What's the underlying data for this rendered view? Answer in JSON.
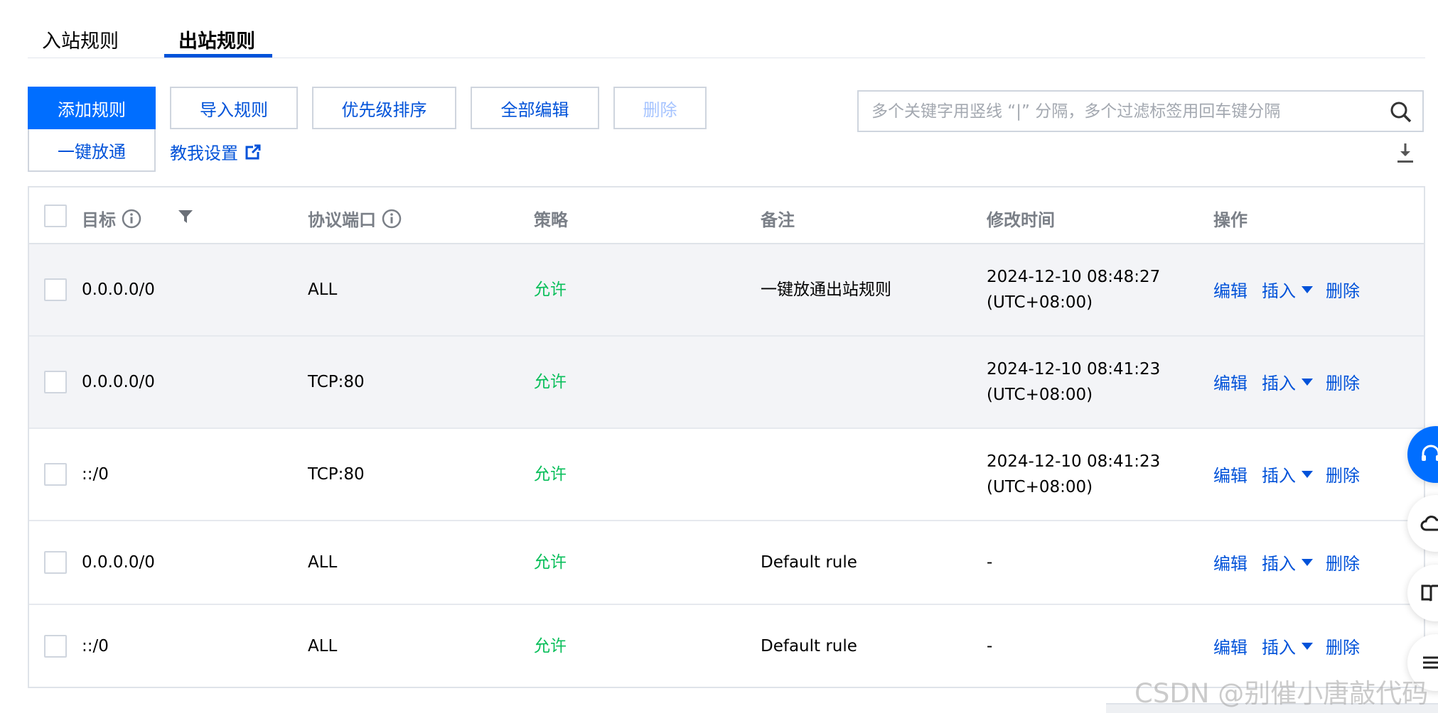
{
  "tabs": [
    {
      "label": "入站规则"
    },
    {
      "label": "出站规则",
      "active": true
    }
  ],
  "toolbar": {
    "add_rule": "添加规则",
    "import_rule": "导入规则",
    "priority_sort": "优先级排序",
    "edit_all": "全部编辑",
    "delete": "删除",
    "one_click_allow": "一键放通",
    "help_link": "教我设置"
  },
  "search": {
    "placeholder": "多个关键字用竖线 “|” 分隔，多个过滤标签用回车键分隔",
    "value": ""
  },
  "table": {
    "headers": {
      "target": "目标",
      "protocol_port": "协议端口",
      "policy": "策略",
      "remark": "备注",
      "modified_time": "修改时间",
      "actions": "操作"
    },
    "rows": [
      {
        "target": "0.0.0.0/0",
        "protocol_port": "ALL",
        "policy": "允许",
        "remark": "一键放通出站规则",
        "time_line1": "2024-12-10 08:48:27",
        "time_line2": "(UTC+08:00)"
      },
      {
        "target": "0.0.0.0/0",
        "protocol_port": "TCP:80",
        "policy": "允许",
        "remark": "",
        "time_line1": "2024-12-10 08:41:23",
        "time_line2": "(UTC+08:00)"
      },
      {
        "target": "::/0",
        "protocol_port": "TCP:80",
        "policy": "允许",
        "remark": "",
        "time_line1": "2024-12-10 08:41:23",
        "time_line2": "(UTC+08:00)"
      },
      {
        "target": "0.0.0.0/0",
        "protocol_port": "ALL",
        "policy": "允许",
        "remark": "Default rule",
        "time_line1": "-",
        "time_line2": ""
      },
      {
        "target": "::/0",
        "protocol_port": "ALL",
        "policy": "允许",
        "remark": "Default rule",
        "time_line1": "-",
        "time_line2": ""
      }
    ],
    "row_actions": {
      "edit": "编辑",
      "insert": "插入",
      "delete": "删除"
    }
  },
  "watermark": "CSDN @别催小唐敲代码",
  "colors": {
    "primary": "#006eff",
    "link": "#0052d9",
    "allow": "#0abf5b",
    "row_highlight": "#f3f4f7"
  },
  "icons": [
    "search-icon",
    "download-icon",
    "info-icon",
    "filter-icon",
    "external-link-icon",
    "headset-icon",
    "cloud-icon",
    "book-icon",
    "list-icon"
  ]
}
